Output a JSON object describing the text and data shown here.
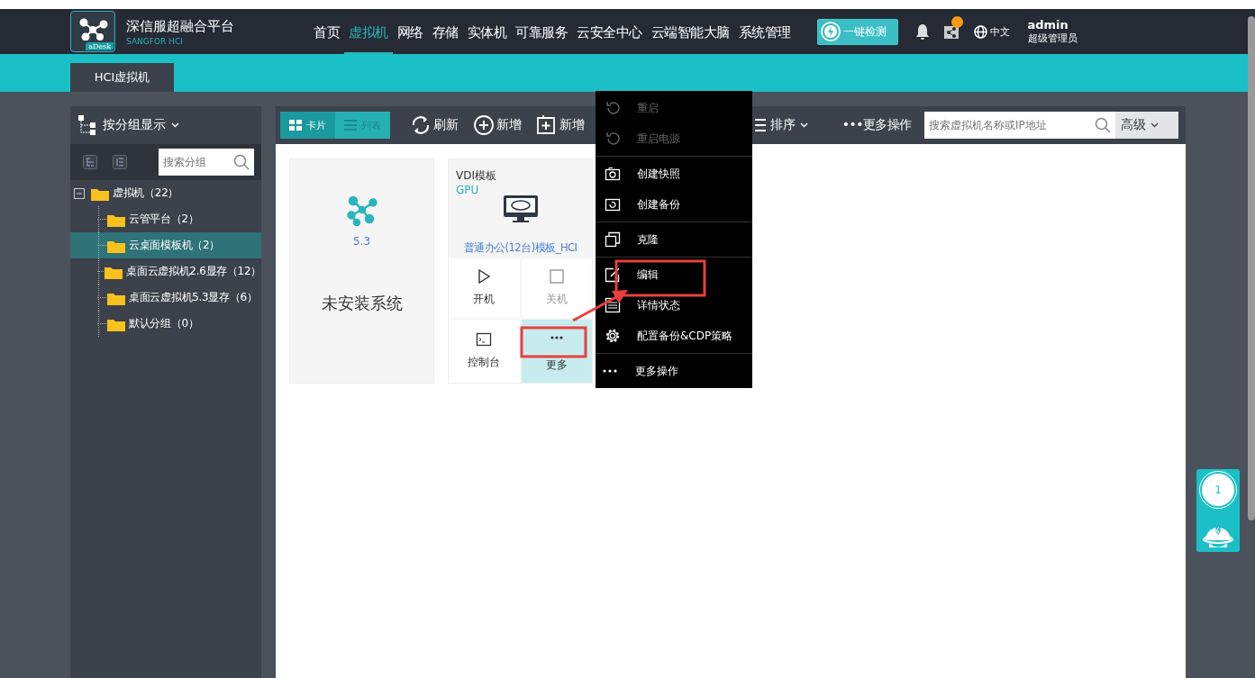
{
  "header": {
    "brand": {
      "badge": "aDesk",
      "title": "深信服超融合平台",
      "subtitle": "SANGFOR HCI"
    },
    "nav": [
      {
        "label": "首页",
        "selected": false
      },
      {
        "label": "虚拟机",
        "selected": true
      },
      {
        "label": "网络",
        "selected": false
      },
      {
        "label": "存储",
        "selected": false
      },
      {
        "label": "实体机",
        "selected": false
      },
      {
        "label": "可靠服务",
        "selected": false
      },
      {
        "label": "云安全中心",
        "selected": false
      },
      {
        "label": "云端智能大脑",
        "selected": false
      },
      {
        "label": "系统管理",
        "selected": false
      }
    ],
    "check_button": "一键检测",
    "notification_badge": true,
    "language": "中文",
    "user": {
      "name": "admin",
      "role": "超级管理员"
    }
  },
  "tabs": [
    {
      "label": "HCI虚拟机",
      "selected": true
    }
  ],
  "sidebar": {
    "view_select": "按分组显示",
    "search": {
      "placeholder": "搜索分组"
    },
    "tree": [
      {
        "label": "虚拟机（22）",
        "expanded": true,
        "selected": false,
        "children": [
          {
            "label": "云管平台（2）",
            "selected": false
          },
          {
            "label": "云桌面模板机（2）",
            "selected": true
          },
          {
            "label": "桌面云虚拟机2.6显存（12）",
            "selected": false
          },
          {
            "label": "桌面云虚拟机5.3显存（6）",
            "selected": false
          },
          {
            "label": "默认分组（0）",
            "selected": false
          }
        ]
      }
    ]
  },
  "toolbar": {
    "views": [
      {
        "label": "卡片",
        "selected": true
      },
      {
        "label": "列表",
        "selected": false
      }
    ],
    "actions": [
      {
        "label": "刷新",
        "kind": "refresh"
      },
      {
        "label": "新增",
        "kind": "add"
      },
      {
        "label": "新增",
        "kind": "add-box"
      }
    ],
    "sort": "排序",
    "more": "•••更多操作",
    "search": {
      "placeholder": "搜索虚拟机名称或IP地址"
    },
    "advanced": "高级"
  },
  "cards": [
    {
      "kind": "blank",
      "version": "5.3",
      "status": "未安装系统"
    },
    {
      "kind": "template",
      "title": "VDI模板",
      "tag": "GPU",
      "name": "普通办公(12台)模板_HCI",
      "actions": [
        {
          "label": "开机",
          "disabled": false,
          "selected": false
        },
        {
          "label": "关机",
          "disabled": true,
          "selected": false
        },
        {
          "label": "控制台",
          "disabled": false,
          "selected": false
        },
        {
          "label": "更多",
          "disabled": false,
          "selected": true
        }
      ]
    }
  ],
  "context_menu": {
    "groups": [
      [
        {
          "label": "重启",
          "disabled": true
        },
        {
          "label": "重启电源",
          "disabled": true
        }
      ],
      [
        {
          "label": "创建快照",
          "disabled": false
        },
        {
          "label": "创建备份",
          "disabled": false
        }
      ],
      [
        {
          "label": "克隆",
          "disabled": false
        }
      ],
      [
        {
          "label": "编辑",
          "disabled": false
        },
        {
          "label": "详情状态",
          "disabled": false
        },
        {
          "label": "配置备份&CDP策略",
          "disabled": false
        }
      ],
      [
        {
          "label": "更多操作",
          "disabled": false
        }
      ]
    ]
  },
  "assistant": {
    "count": "1"
  }
}
